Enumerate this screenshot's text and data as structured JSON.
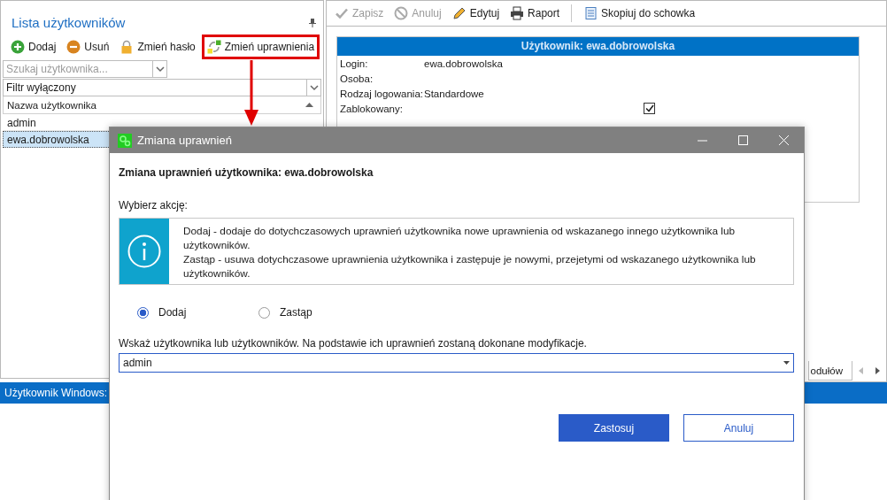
{
  "left_panel": {
    "title": "Lista użytkowników",
    "toolbar": [
      {
        "label": "Dodaj",
        "kind": "add",
        "highlighted": false
      },
      {
        "label": "Usuń",
        "kind": "remove",
        "highlighted": false
      },
      {
        "label": "Zmień hasło",
        "kind": "lock",
        "highlighted": false
      },
      {
        "label": "Zmień uprawnienia",
        "kind": "permissions",
        "highlighted": true
      }
    ],
    "search": {
      "placeholder": "Szukaj użytkownika..."
    },
    "filter": {
      "value": "Filtr wyłączony"
    },
    "table": {
      "columns": [
        "Nazwa użytkownika"
      ],
      "rows": [
        {
          "name": "admin",
          "selected": false
        },
        {
          "name": "ewa.dobrowolska",
          "selected": true
        }
      ]
    }
  },
  "right_panel": {
    "toolbar": [
      {
        "label": "Zapisz",
        "kind": "save",
        "disabled": true
      },
      {
        "label": "Anuluj",
        "kind": "cancel",
        "disabled": true
      },
      {
        "label": "Edytuj",
        "kind": "edit",
        "disabled": false
      },
      {
        "label": "Raport",
        "kind": "print",
        "disabled": false
      },
      {
        "label": "Skopiuj do schowka",
        "kind": "copy",
        "disabled": false
      }
    ],
    "card": {
      "title": "Użytkownik: ewa.dobrowolska",
      "fields": [
        {
          "label": "Login:",
          "kind": "text",
          "value": "ewa.dobrowolska"
        },
        {
          "label": "Osoba:",
          "kind": "text"
        },
        {
          "label": "Rodzaj logowania:",
          "kind": "text",
          "value": "Standardowe"
        },
        {
          "label": "Zablokowany:",
          "kind": "checkbox",
          "checked": true
        }
      ]
    },
    "tabs": [
      {
        "label": "odułów",
        "selected": true
      }
    ]
  },
  "status_bar": {
    "label": "Użytkownik Windows:"
  },
  "dialog": {
    "title": "Zmiana uprawnień",
    "heading": "Zmiana uprawnień użytkownika: ewa.dobrowolska",
    "action_label": "Wybierz akcję:",
    "info": [
      "Dodaj - dodaje do dotychczasowych uprawnień użytkownika nowe uprawnienia od wskazanego innego użytkownika lub użytkowników.",
      "Zastąp - usuwa dotychczasowe uprawnienia użytkownika i zastępuje je nowymi, przejetymi od wskazanego użytkownika lub użytkowników."
    ],
    "actions": [
      {
        "label": "Dodaj",
        "selected": true
      },
      {
        "label": "Zastąp",
        "selected": false
      }
    ],
    "users_label": "Wskaż użytkownika lub użytkowników. Na podstawie ich uprawnień zostaną dokonane modyfikacje.",
    "users_value": "admin",
    "buttons": [
      {
        "label": "Zastosuj",
        "kind": "primary"
      },
      {
        "label": "Anuluj",
        "kind": "secondary"
      }
    ]
  }
}
